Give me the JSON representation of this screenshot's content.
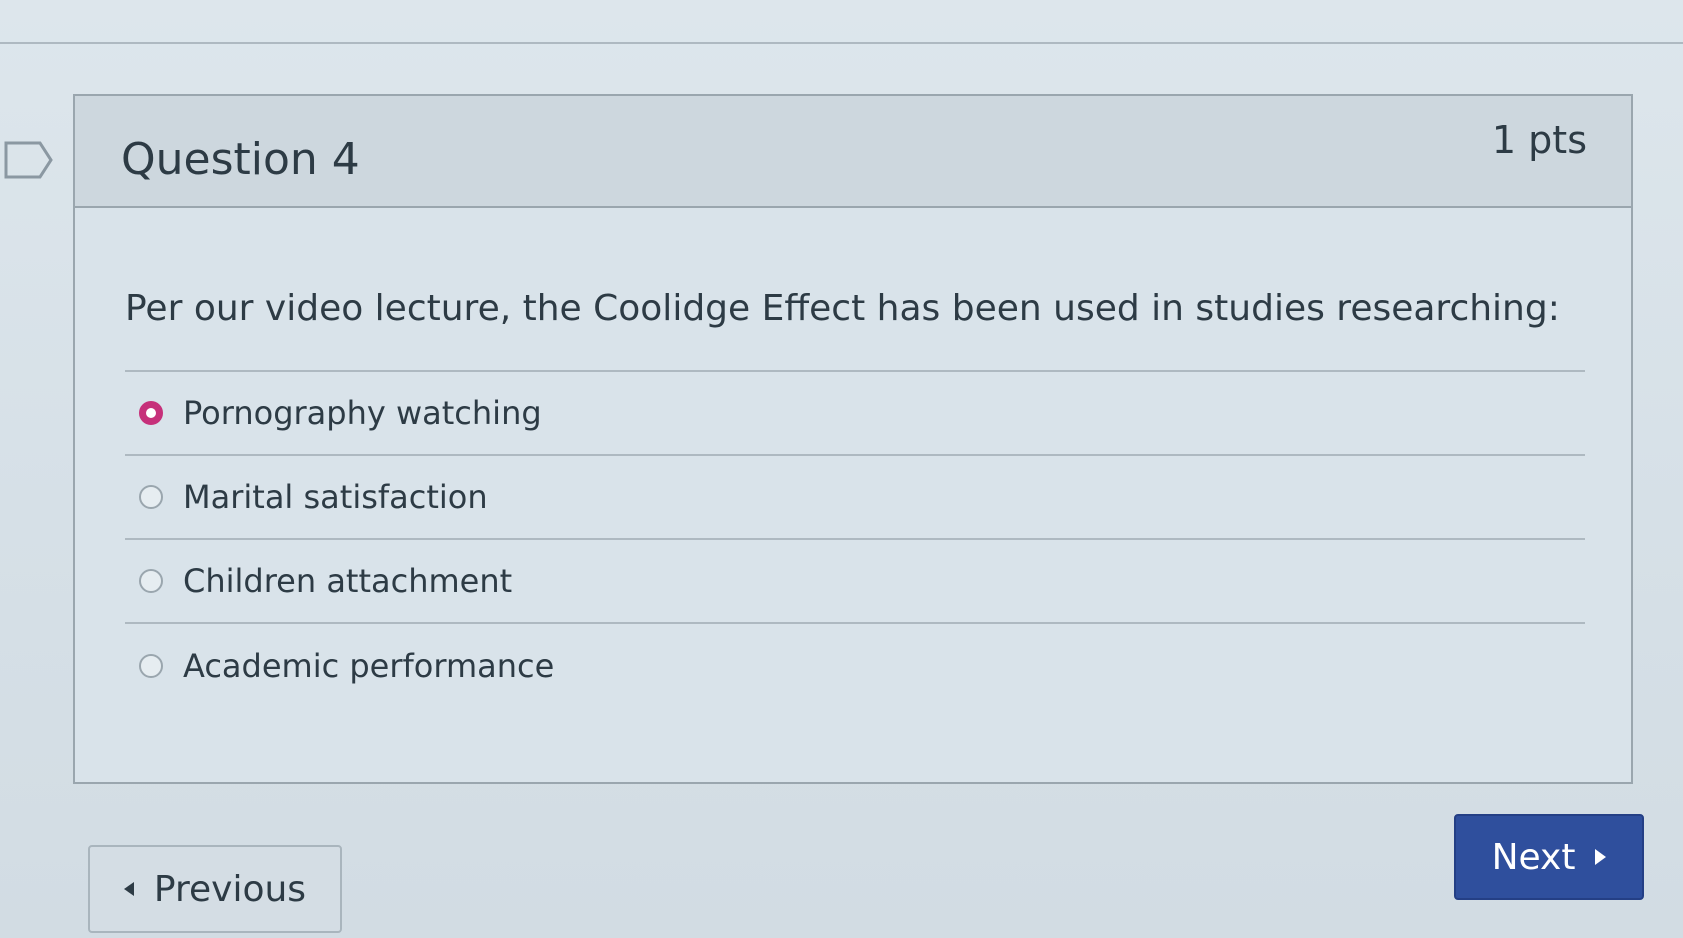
{
  "question": {
    "title": "Question 4",
    "points": "1 pts",
    "text": "Per our video lecture, the Coolidge Effect has been used in studies researching:",
    "answers": [
      {
        "label": "Pornography watching",
        "selected": true
      },
      {
        "label": "Marital satisfaction",
        "selected": false
      },
      {
        "label": "Children attachment",
        "selected": false
      },
      {
        "label": "Academic performance",
        "selected": false
      }
    ]
  },
  "navigation": {
    "previous_label": "Previous",
    "next_label": "Next"
  },
  "colors": {
    "selected_radio": "#c6307a",
    "next_button": "#2f4f9d"
  },
  "icons": {
    "flag": "flag-icon",
    "previous": "caret-left-icon",
    "next": "caret-right-icon"
  }
}
